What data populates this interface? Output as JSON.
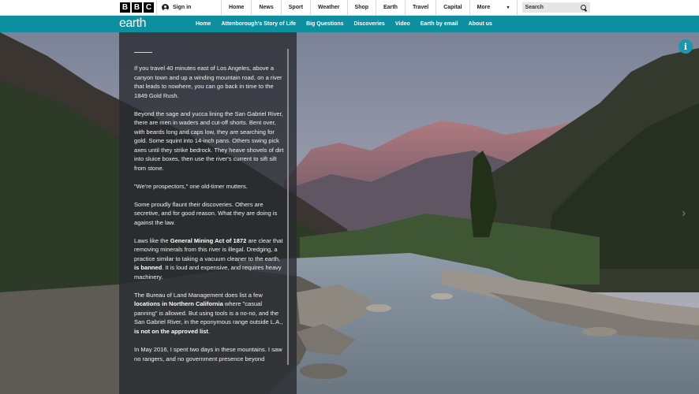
{
  "header": {
    "logo_letters": [
      "B",
      "B",
      "C"
    ],
    "signin_label": "Sign in",
    "nav": [
      "Home",
      "News",
      "Sport",
      "Weather",
      "Shop",
      "Earth",
      "Travel",
      "Capital"
    ],
    "more_label": "More",
    "more_chevron": "▾",
    "search_placeholder": "Search"
  },
  "earth_nav": {
    "logo": "earth",
    "items": [
      "Home",
      "Attenborough's Story of Life",
      "Big Questions",
      "Discoveries",
      "Video",
      "Earth by email",
      "About us"
    ]
  },
  "article": {
    "p1": "If you travel 40 minutes east of Los Angeles, above a canyon town and up a winding mountain road, on a river that leads to nowhere, you can go back in time to the 1849 Gold Rush.",
    "p2": "Beyond the sage and yucca lining the San Gabriel River, there are men in waders and cut-off shorts. Bent over, with beards long and caps low, they are searching for gold. Some squint into 14-inch pans. Others swing pick axes until they strike bedrock. They heave shovels of dirt into sluice boxes, then use the river's current to sift silt from stone.",
    "p3": "\"We're prospectors,\" one old-timer mutters.",
    "p4": "Some proudly flaunt their discoveries. Others are secretive, and for good reason. What they are doing is against the law.",
    "p5_a": "Laws like the ",
    "p5_b": "General Mining Act of 1872",
    "p5_c": " are clear that removing minerals from this river is illegal. Dredging, a practice similar to taking a vacuum cleaner to the earth, ",
    "p5_d": "is banned",
    "p5_e": ". It is loud and expensive, and requires heavy machinery.",
    "p6_a": "The Bureau of Land Management does list a few ",
    "p6_b": "locations in Northern California",
    "p6_c": " where \"casual panning\" is allowed. But using tools is a no-no, and the San Gabriel River, in the eponymous range outside L.A., ",
    "p6_d": "is not on the approved list",
    "p6_e": ".",
    "p7": "In May 2016, I spent two days in these mountains. I saw no rangers, and no government presence beyond"
  },
  "hero": {
    "info_label": "i",
    "next_arrow": "›"
  }
}
